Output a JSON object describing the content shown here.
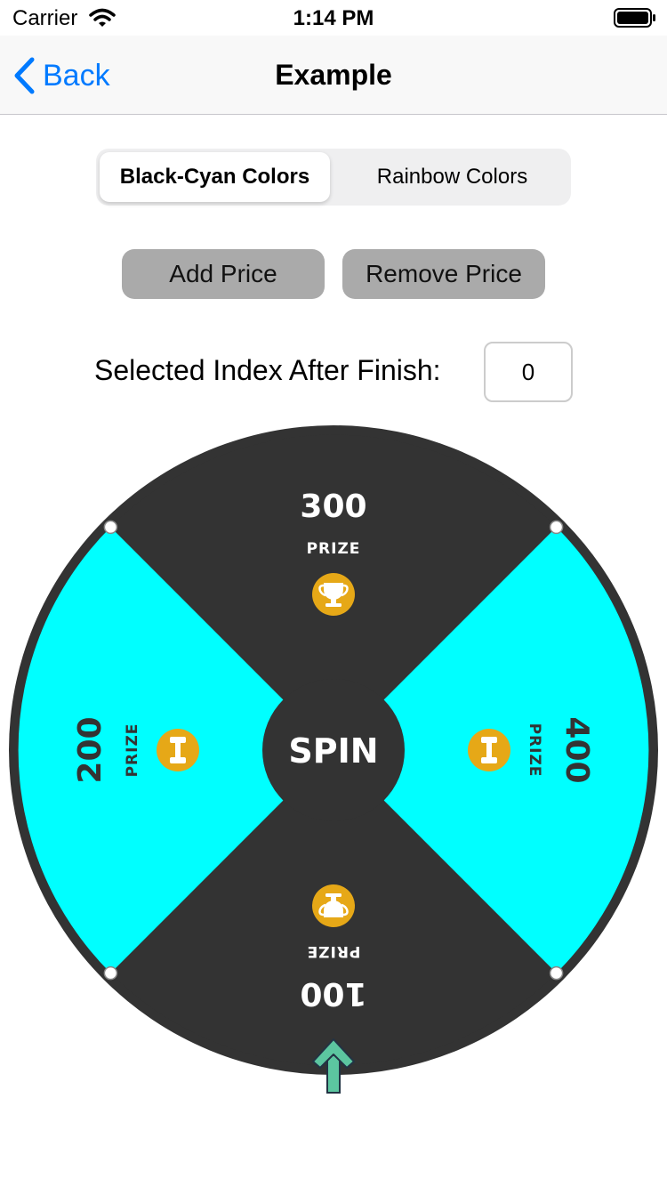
{
  "status_bar": {
    "carrier": "Carrier",
    "time": "1:14 PM"
  },
  "nav": {
    "back_label": "Back",
    "title": "Example"
  },
  "segmented_control": {
    "options": [
      "Black-Cyan Colors",
      "Rainbow Colors"
    ],
    "selected_index": 0
  },
  "buttons": {
    "add_label": "Add Price",
    "remove_label": "Remove Price"
  },
  "selected_index": {
    "label": "Selected Index After Finish:",
    "value": "0"
  },
  "wheel": {
    "center_label": "SPIN",
    "prize_caption": "PRIZE",
    "slices": [
      {
        "value": "300",
        "position": "top",
        "color": "#333333",
        "icon": "trophy-icon"
      },
      {
        "value": "400",
        "position": "right",
        "color": "#00ffff",
        "icon": "dumbbell-icon"
      },
      {
        "value": "100",
        "position": "bottom",
        "color": "#333333",
        "icon": "trophy-icon"
      },
      {
        "value": "200",
        "position": "left",
        "color": "#00ffff",
        "icon": "dumbbell-icon"
      }
    ],
    "colors": {
      "dark": "#333333",
      "cyan": "#00ffff",
      "icon_badge": "#e6a817",
      "pointer": "#5cc6a0"
    }
  }
}
